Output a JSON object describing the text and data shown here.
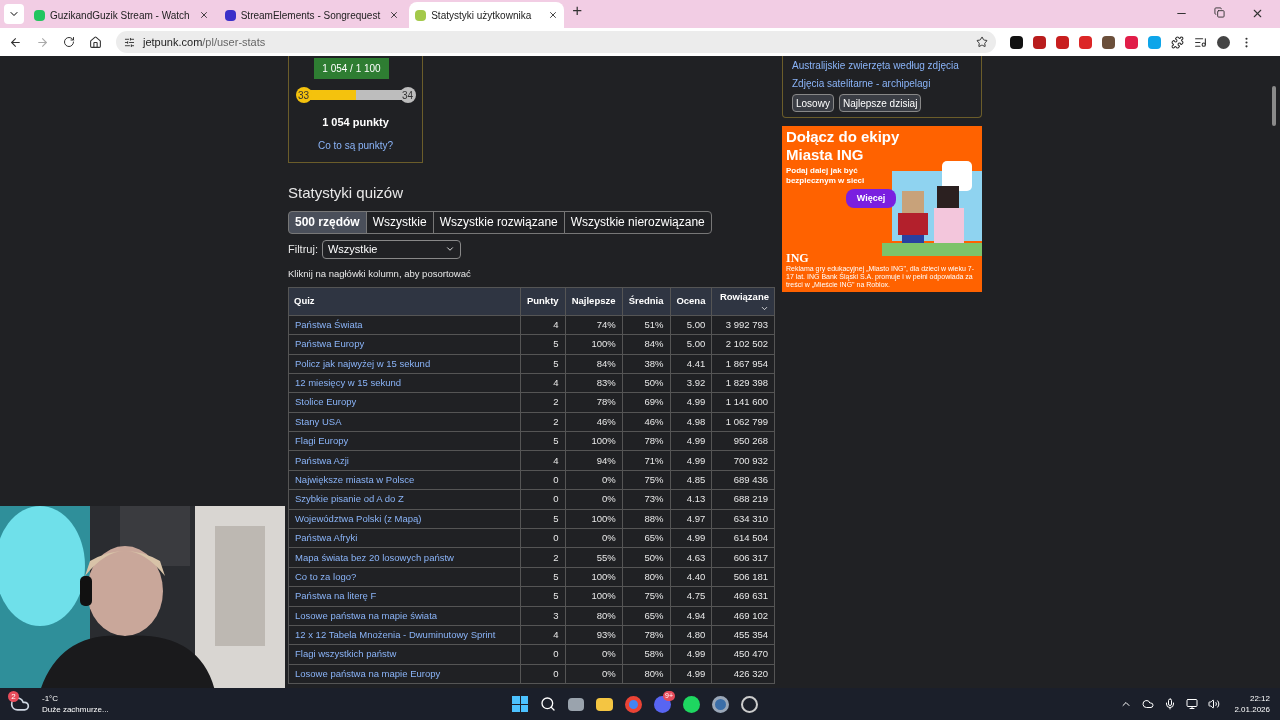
{
  "browser": {
    "tabs": [
      {
        "title": "GuzikandGuzik Stream - Watch",
        "selected": false,
        "color": "#22c55e"
      },
      {
        "title": "StreamElements - Songrequest",
        "selected": false,
        "color": "#3b2fc9"
      },
      {
        "title": "Statystyki użytkownika",
        "selected": true,
        "color": "#a3c94a"
      }
    ],
    "new_tab": "+",
    "url_host": "jetpunk.com",
    "url_path": "/pl/user-stats"
  },
  "level_card": {
    "tooltip": "1 054 / 1 100",
    "from": "33",
    "to": "34",
    "level": 0.5,
    "points": "1 054 punkty",
    "help_link": "Co to są punkty?"
  },
  "stats": {
    "title": "Statystyki quizów",
    "filters": [
      {
        "label": "500 rzędów",
        "selected": true
      },
      {
        "label": "Wszystkie",
        "selected": false
      },
      {
        "label": "Wszystkie rozwiązane",
        "selected": false
      },
      {
        "label": "Wszystkie nierozwiązane",
        "selected": false
      }
    ],
    "filter_label": "Filtruj:",
    "filter_value": "Wszystkie",
    "hint": "Kliknij na nagłówki kolumn, aby posortować",
    "columns": [
      {
        "label": "Quiz",
        "sorted": false
      },
      {
        "label": "Punkty",
        "sorted": false
      },
      {
        "label": "Najlepsze",
        "sorted": false
      },
      {
        "label": "Średnia",
        "sorted": false
      },
      {
        "label": "Ocena",
        "sorted": false
      },
      {
        "label": "Rowiązane",
        "sorted": true
      }
    ],
    "rows": [
      [
        "Państwa Świata",
        "4",
        "74%",
        "51%",
        "5.00",
        "3 992 793"
      ],
      [
        "Państwa Europy",
        "5",
        "100%",
        "84%",
        "5.00",
        "2 102 502"
      ],
      [
        "Policz jak najwyżej w 15 sekund",
        "5",
        "84%",
        "38%",
        "4.41",
        "1 867 954"
      ],
      [
        "12 miesięcy w 15 sekund",
        "4",
        "83%",
        "50%",
        "3.92",
        "1 829 398"
      ],
      [
        "Stolice Europy",
        "2",
        "78%",
        "69%",
        "4.99",
        "1 141 600"
      ],
      [
        "Stany USA",
        "2",
        "46%",
        "46%",
        "4.98",
        "1 062 799"
      ],
      [
        "Flagi Europy",
        "5",
        "100%",
        "78%",
        "4.99",
        "950 268"
      ],
      [
        "Państwa Azji",
        "4",
        "94%",
        "71%",
        "4.99",
        "700 932"
      ],
      [
        "Największe miasta w Polsce",
        "0",
        "0%",
        "75%",
        "4.85",
        "689 436"
      ],
      [
        "Szybkie pisanie od A do Z",
        "0",
        "0%",
        "73%",
        "4.13",
        "688 219"
      ],
      [
        "Województwa Polski (z Mapą)",
        "5",
        "100%",
        "88%",
        "4.97",
        "634 310"
      ],
      [
        "Państwa Afryki",
        "0",
        "0%",
        "65%",
        "4.99",
        "614 504"
      ],
      [
        "Mapa świata bez 20 losowych państw",
        "2",
        "55%",
        "50%",
        "4.63",
        "606 317"
      ],
      [
        "Co to za logo?",
        "5",
        "100%",
        "80%",
        "4.40",
        "506 181"
      ],
      [
        "Państwa na literę F",
        "5",
        "100%",
        "75%",
        "4.75",
        "469 631"
      ],
      [
        "Losowe państwa na mapie świata",
        "3",
        "80%",
        "65%",
        "4.94",
        "469 102"
      ],
      [
        "12 x 12 Tabela Mnożenia - Dwuminutowy Sprint",
        "4",
        "93%",
        "78%",
        "4.80",
        "455 354"
      ],
      [
        "Flagi wszystkich państw",
        "0",
        "0%",
        "58%",
        "4.99",
        "450 470"
      ],
      [
        "Losowe państwa na mapie Europy",
        "0",
        "0%",
        "80%",
        "4.99",
        "426 320"
      ]
    ]
  },
  "sidebar": {
    "links": [
      "Australijskie zwierzęta według zdjęcia",
      "Zdjęcia satelitarne - archipelagi"
    ],
    "buttons": [
      "Losowy",
      "Najlepsze dzisiaj"
    ]
  },
  "ad": {
    "headline": "Dołącz do ekipy Miasta ING",
    "subline": "Podaj dalej jak być bezpiecznym w sieci",
    "cta": "Więcej",
    "brand": "ING",
    "disclaimer": "Reklama gry edukacyjnej „Miasto ING\", dla dzieci w wieku 7-17 lat. ING Bank Śląski S.A. promuje i w pełni odpowiada za treści w „Mieście ING\" na Roblox."
  },
  "taskbar": {
    "weather_badge": "2",
    "temperature": "-1°C",
    "weather": "Duże zachmurze...",
    "discord_badge": "9+",
    "time": "22:12",
    "date": "2.01.2026"
  }
}
